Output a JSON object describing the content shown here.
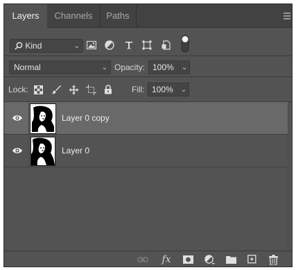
{
  "tabs": [
    {
      "label": "Layers",
      "active": true
    },
    {
      "label": "Channels",
      "active": false
    },
    {
      "label": "Paths",
      "active": false
    }
  ],
  "filter": {
    "kind_label": "Kind",
    "icons": [
      "pixel-filter-icon",
      "adjustment-filter-icon",
      "type-filter-icon",
      "shape-filter-icon",
      "smart-object-filter-icon",
      "filter-toggle-icon"
    ]
  },
  "blend": {
    "mode": "Normal",
    "opacity_label": "Opacity:",
    "opacity_value": "100%"
  },
  "lock": {
    "label": "Lock:",
    "fill_label": "Fill:",
    "fill_value": "100%"
  },
  "layers": [
    {
      "name": "Layer 0 copy",
      "visible": true,
      "selected": true
    },
    {
      "name": "Layer 0",
      "visible": true,
      "selected": false
    }
  ],
  "colors": {
    "panel_bg": "#535353",
    "selected_row": "#696969",
    "tab_bar": "#424242"
  }
}
